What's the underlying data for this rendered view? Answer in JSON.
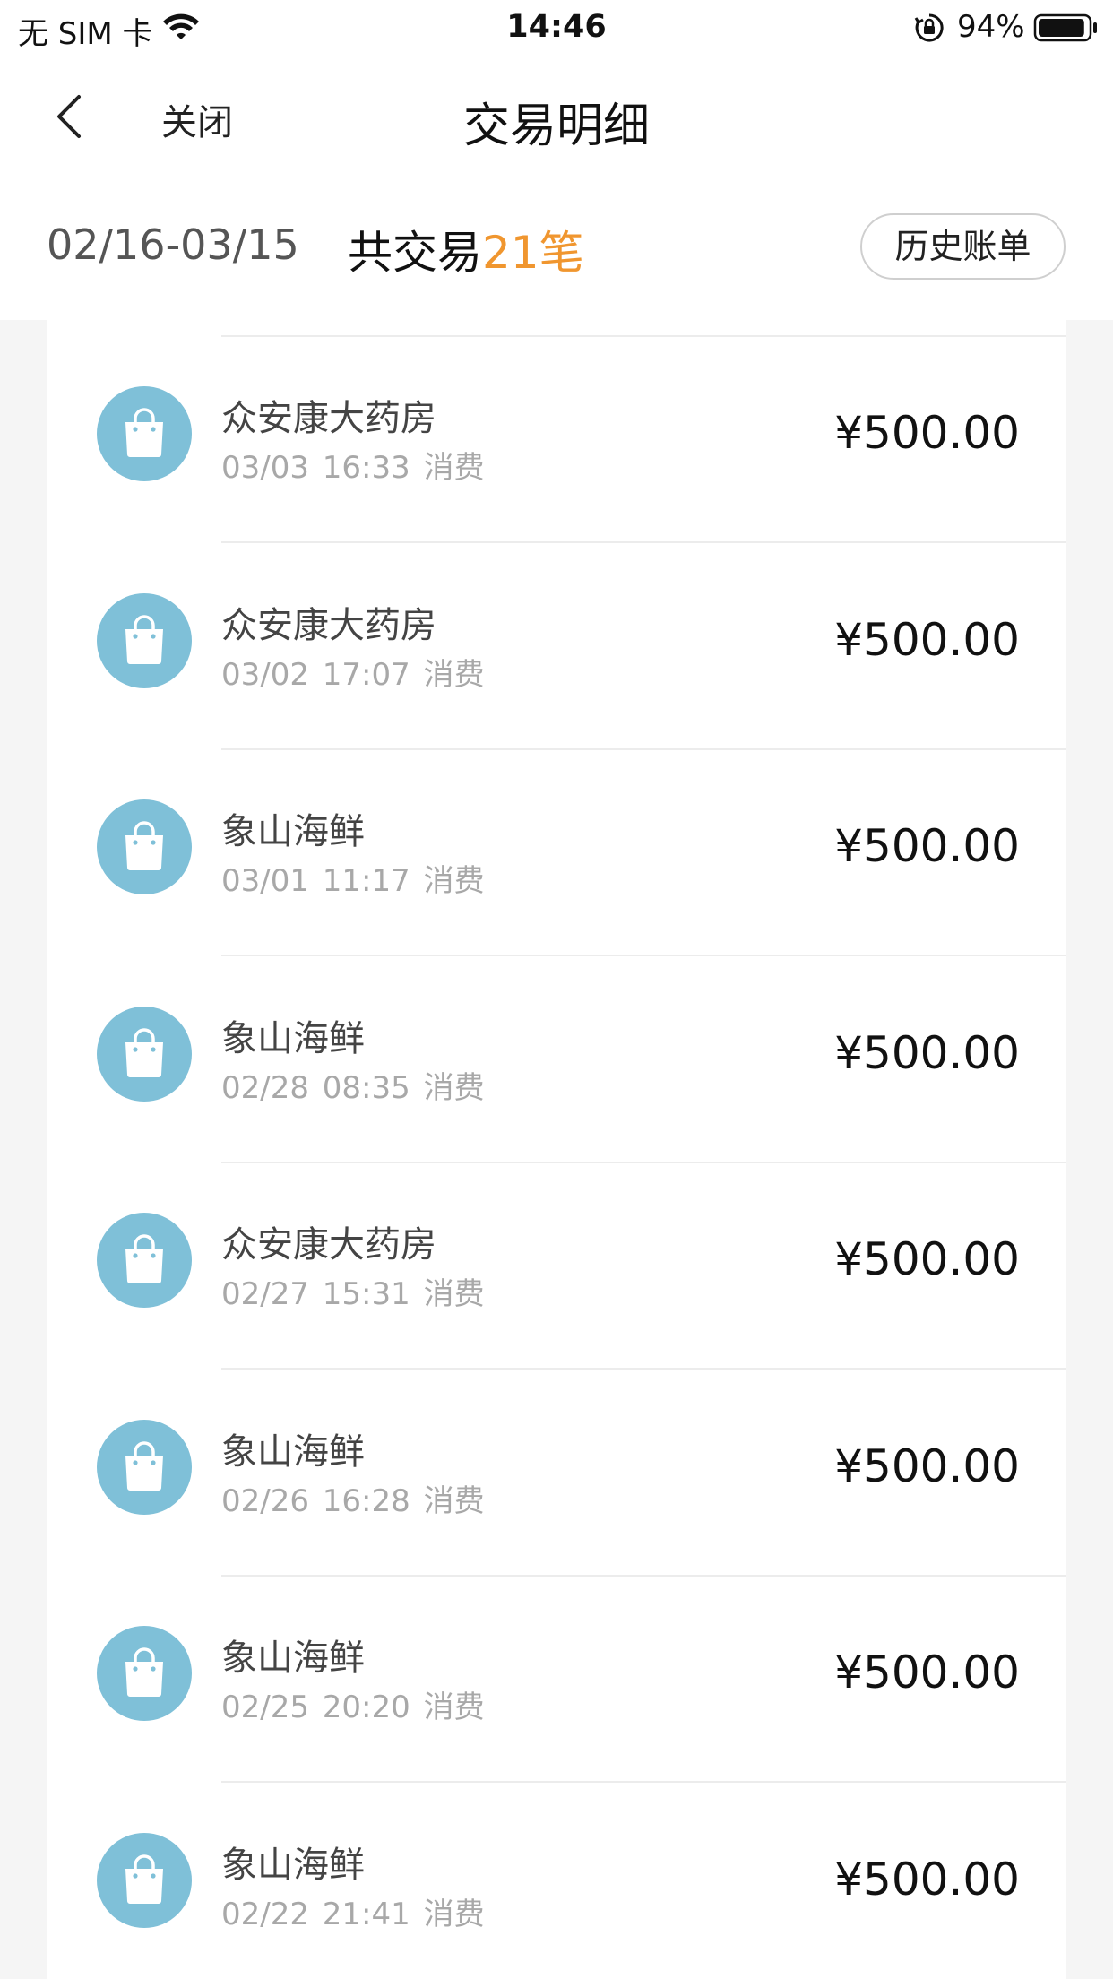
{
  "status_bar": {
    "carrier": "无 SIM 卡",
    "time": "14:46",
    "battery_percent": "94%",
    "battery_level": 0.94
  },
  "nav": {
    "close_label": "关闭",
    "title": "交易明细"
  },
  "summary": {
    "date_range": "02/16-03/15",
    "count_prefix": "共交易",
    "count": "21笔",
    "history_button": "历史账单"
  },
  "icons": {
    "back": "chevron-left-icon",
    "transaction": "shopping-bag-icon",
    "icon_bg_color": "#7fc0d8",
    "accent_color": "#f0962f"
  },
  "transactions": [
    {
      "merchant": "众安康大药房",
      "date": "03/03",
      "time": "16:33",
      "type": "消费",
      "amount": "¥500.00"
    },
    {
      "merchant": "众安康大药房",
      "date": "03/02",
      "time": "17:07",
      "type": "消费",
      "amount": "¥500.00"
    },
    {
      "merchant": "象山海鲜",
      "date": "03/01",
      "time": "11:17",
      "type": "消费",
      "amount": "¥500.00"
    },
    {
      "merchant": "象山海鲜",
      "date": "02/28",
      "time": "08:35",
      "type": "消费",
      "amount": "¥500.00"
    },
    {
      "merchant": "众安康大药房",
      "date": "02/27",
      "time": "15:31",
      "type": "消费",
      "amount": "¥500.00"
    },
    {
      "merchant": "象山海鲜",
      "date": "02/26",
      "time": "16:28",
      "type": "消费",
      "amount": "¥500.00"
    },
    {
      "merchant": "象山海鲜",
      "date": "02/25",
      "time": "20:20",
      "type": "消费",
      "amount": "¥500.00"
    },
    {
      "merchant": "象山海鲜",
      "date": "02/22",
      "time": "21:41",
      "type": "消费",
      "amount": "¥500.00"
    }
  ]
}
